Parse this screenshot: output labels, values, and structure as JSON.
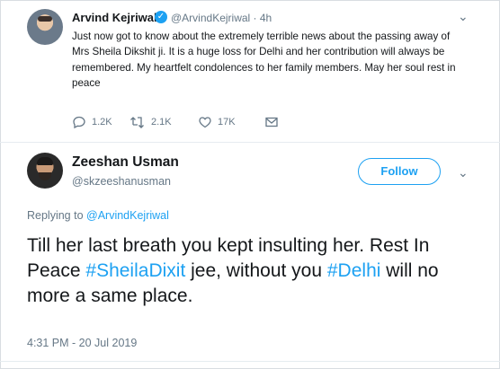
{
  "parent_tweet": {
    "author_name": "Arvind Kejriwal",
    "handle_time": "@ArvindKejriwal · 4h",
    "text": "Just now got to know about the extremely terrible news about the passing away of Mrs Sheila Dikshit ji. It is a huge loss for Delhi and her contribution will always be remembered. My heartfelt condolences to her family members. May her soul rest in peace",
    "replies": "1.2K",
    "retweets": "2.1K",
    "likes": "17K",
    "icons": [
      "verified-badge-icon",
      "reply-icon",
      "retweet-icon",
      "like-icon",
      "message-icon",
      "chevron-down-icon"
    ]
  },
  "reply_tweet": {
    "author_name": "Zeeshan Usman",
    "handle": "@skzeeshanusman",
    "follow_label": "Follow",
    "replying_prefix": "Replying to ",
    "replying_to": "@ArvindKejriwal",
    "text_part1": "Till her last breath you kept insulting her. Rest In Peace ",
    "hashtag1": "#SheilaDixit",
    "text_part2": " jee, without you ",
    "hashtag2": "#Delhi",
    "text_part3": " will no more a same place.",
    "timestamp": "4:31 PM - 20 Jul 2019"
  },
  "colors": {
    "accent": "#1da1f2",
    "text": "#14171a",
    "muted": "#657786",
    "divider": "#e6ecf0"
  }
}
